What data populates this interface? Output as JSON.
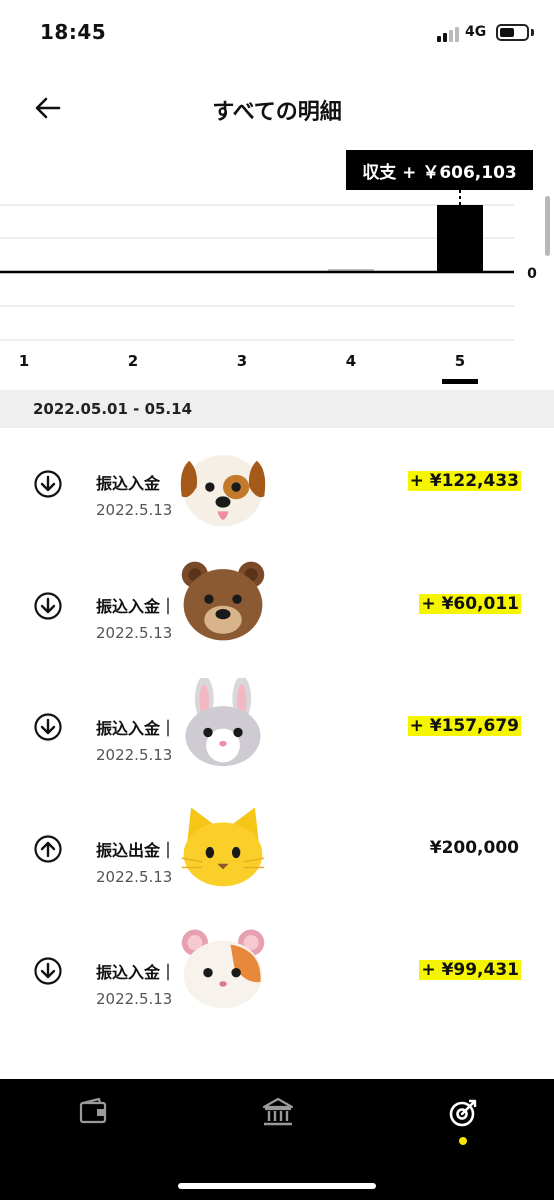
{
  "status_bar": {
    "time": "18:45",
    "network": "4G",
    "battery_level": 0.55
  },
  "header": {
    "title": "すべての明細"
  },
  "chart_data": {
    "type": "bar",
    "categories": [
      "1",
      "2",
      "3",
      "4",
      "5"
    ],
    "values": [
      0,
      0,
      0,
      500,
      606103
    ],
    "selected_index": 4,
    "zero_label": "0",
    "tooltip": "収支 + ￥606,103"
  },
  "period": {
    "label": "2022.05.01 - 05.14"
  },
  "transactions": [
    {
      "type": "in",
      "title": "振込入金",
      "date": "2022.5.13",
      "amount": "+ ¥122,433",
      "highlight": true,
      "avatar": "dog-emoji"
    },
    {
      "type": "in",
      "title": "振込入金｜",
      "date": "2022.5.13",
      "amount": "+ ¥60,011",
      "highlight": true,
      "avatar": "bear-emoji"
    },
    {
      "type": "in",
      "title": "振込入金｜",
      "date": "2022.5.13",
      "amount": "+ ¥157,679",
      "highlight": true,
      "avatar": "rabbit-emoji"
    },
    {
      "type": "out",
      "title": "振込出金｜",
      "date": "2022.5.13",
      "amount": "¥200,000",
      "highlight": false,
      "avatar": "cat-emoji"
    },
    {
      "type": "in",
      "title": "振込入金｜",
      "date": "2022.5.13",
      "amount": "+ ¥99,431",
      "highlight": true,
      "avatar": "hamster-emoji"
    }
  ],
  "nav": {
    "items": [
      {
        "icon": "wallet-icon"
      },
      {
        "icon": "bank-icon"
      },
      {
        "icon": "target-icon",
        "active": true
      }
    ]
  },
  "colors": {
    "highlight": "#f5f500",
    "nav_active": "#f2e600",
    "bar": "#000000"
  }
}
